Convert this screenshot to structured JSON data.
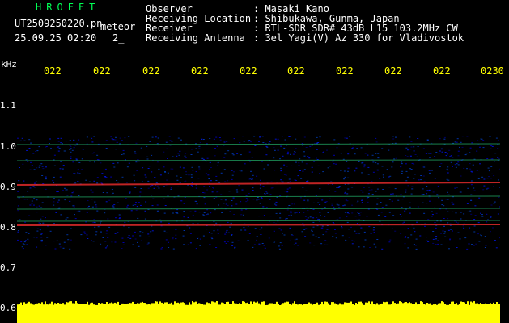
{
  "header": {
    "app_name": "HROFFT",
    "filename": "UT2509250220.pn",
    "mode": "meteor",
    "datetime": "25.09.25 02:20",
    "extra": "2_"
  },
  "info": {
    "labels": [
      "Observer",
      "Receiving Location",
      "Receiver",
      "Receiving Antenna"
    ],
    "values": [
      ": Masaki Kano",
      ": Shibukawa, Gunma, Japan",
      ": RTL-SDR SDR# 43dB L15 103.2MHz CW",
      ": 3el Yagi(V) Az 330 for Vladivostok"
    ]
  },
  "axis": {
    "unit": "kHz",
    "y_ticks": [
      "1.1",
      "1.0",
      "0.9",
      "0.8",
      "0.7",
      "0.6"
    ],
    "x_ticks": [
      "022",
      "022",
      "022",
      "022",
      "022",
      "022",
      "022",
      "022",
      "022",
      "0230"
    ]
  },
  "colors": {
    "background": "#000000",
    "noise": "#0000aa",
    "signal": "#ff3030",
    "level_bar": "#ffff00",
    "title": "#00ff55"
  },
  "spectrogram": {
    "signal_lines_khz": [
      1.0,
      0.96,
      0.9,
      0.87,
      0.84,
      0.81,
      0.8
    ]
  }
}
